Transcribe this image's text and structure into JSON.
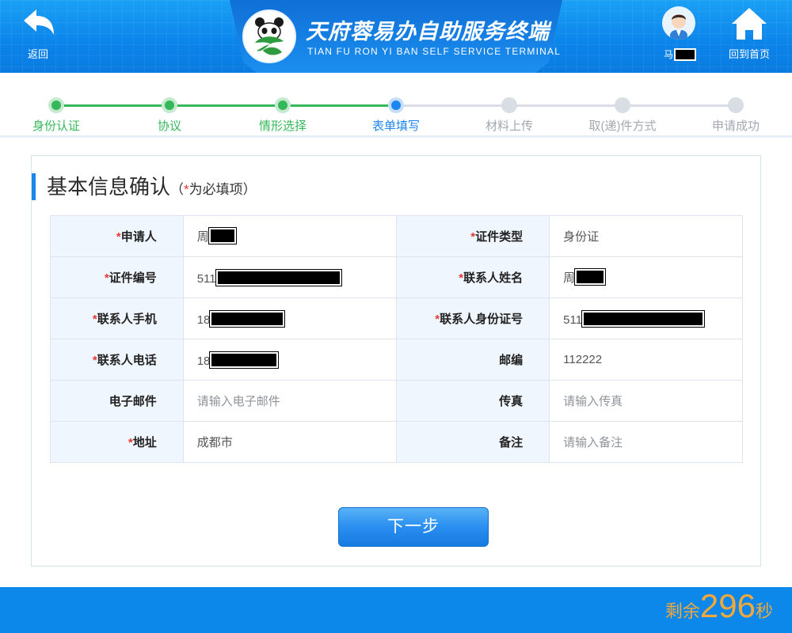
{
  "header": {
    "back_label": "返回",
    "home_label": "回到首页",
    "title_cn": "天府蓉易办自助服务终端",
    "title_en": "TIAN FU RON YI BAN SELF SERVICE TERMINAL",
    "user_name_prefix": "马",
    "logo_icon": "panda-logo-icon",
    "colors": {
      "header_bg": "#0b84ea",
      "accent": "#1c86ef"
    }
  },
  "steps": [
    {
      "label": "身份认证",
      "status": "done"
    },
    {
      "label": "协议",
      "status": "done"
    },
    {
      "label": "情形选择",
      "status": "done"
    },
    {
      "label": "表单填写",
      "status": "current"
    },
    {
      "label": "材料上传",
      "status": "todo"
    },
    {
      "label": "取(递)件方式",
      "status": "todo"
    },
    {
      "label": "申请成功",
      "status": "todo"
    }
  ],
  "form": {
    "title": "基本信息确认",
    "note_open": "（",
    "note_star": "*",
    "note_text": "为必填项",
    "note_close": "）",
    "rows": [
      {
        "l_label": "申请人",
        "l_req": "*",
        "l_value": "周",
        "r_label": "证件类型",
        "r_req": "*",
        "r_value": "身份证"
      },
      {
        "l_label": "证件编号",
        "l_req": "*",
        "l_value": "511",
        "r_label": "联系人姓名",
        "r_req": "*",
        "r_value": "周"
      },
      {
        "l_label": "联系人手机",
        "l_req": "*",
        "l_value": "18",
        "r_label": "联系人身份证号",
        "r_req": "*",
        "r_value": "511"
      },
      {
        "l_label": "联系人电话",
        "l_req": "*",
        "l_value": "18",
        "r_label": "邮编",
        "r_req": "",
        "r_value": "112222"
      },
      {
        "l_label": "电子邮件",
        "l_req": "",
        "l_value": "请输入电子邮件",
        "r_label": "传真",
        "r_req": "",
        "r_value": "请输入传真"
      },
      {
        "l_label": "地址",
        "l_req": "*",
        "l_value": "成都市",
        "r_label": "备注",
        "r_req": "",
        "r_value": "请输入备注"
      }
    ],
    "next_label": "下一步"
  },
  "footer": {
    "timer_prefix": "剩余",
    "timer_seconds": "296",
    "timer_suffix": "秒"
  }
}
